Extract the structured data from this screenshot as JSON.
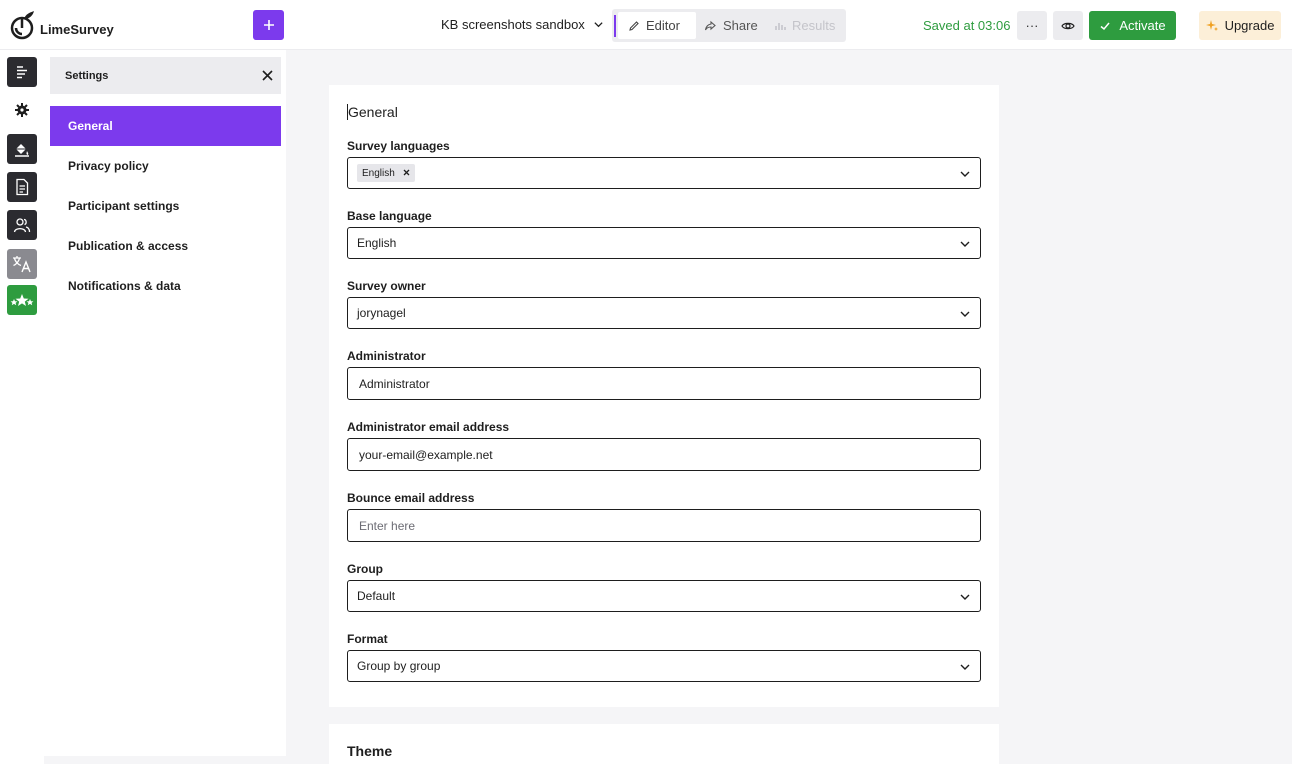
{
  "app": {
    "name": "LimeSurvey"
  },
  "header": {
    "survey_title": "KB screenshots sandbox",
    "modes": {
      "editor": "Editor",
      "share": "Share",
      "results": "Results"
    },
    "saved_status": "Saved at 03:06",
    "more_label": "···",
    "activate_label": "Activate",
    "upgrade_label": "Upgrade"
  },
  "rail": {
    "icons": [
      "structure-icon",
      "settings-icon",
      "theme-paint-icon",
      "document-icon",
      "participants-icon",
      "translate-icon",
      "ratings-icon"
    ]
  },
  "panel": {
    "title": "Settings",
    "items": [
      {
        "label": "General",
        "active": true
      },
      {
        "label": "Privacy policy",
        "active": false
      },
      {
        "label": "Participant settings",
        "active": false
      },
      {
        "label": "Publication & access",
        "active": false
      },
      {
        "label": "Notifications & data",
        "active": false
      }
    ]
  },
  "general": {
    "title": "General",
    "survey_languages": {
      "label": "Survey languages",
      "chips": [
        "English"
      ]
    },
    "base_language": {
      "label": "Base language",
      "value": "English"
    },
    "survey_owner": {
      "label": "Survey owner",
      "value": "jorynagel"
    },
    "administrator": {
      "label": "Administrator",
      "value": "Administrator"
    },
    "admin_email": {
      "label": "Administrator email address",
      "value": "your-email@example.net"
    },
    "bounce_email": {
      "label": "Bounce email address",
      "value": "",
      "placeholder": "Enter here"
    },
    "group": {
      "label": "Group",
      "value": "Default"
    },
    "format": {
      "label": "Format",
      "value": "Group by group"
    }
  },
  "theme": {
    "title": "Theme"
  },
  "colors": {
    "accent": "#7c3aed",
    "success": "#2e9c3f",
    "upgrade_bg": "#fcefd8"
  }
}
